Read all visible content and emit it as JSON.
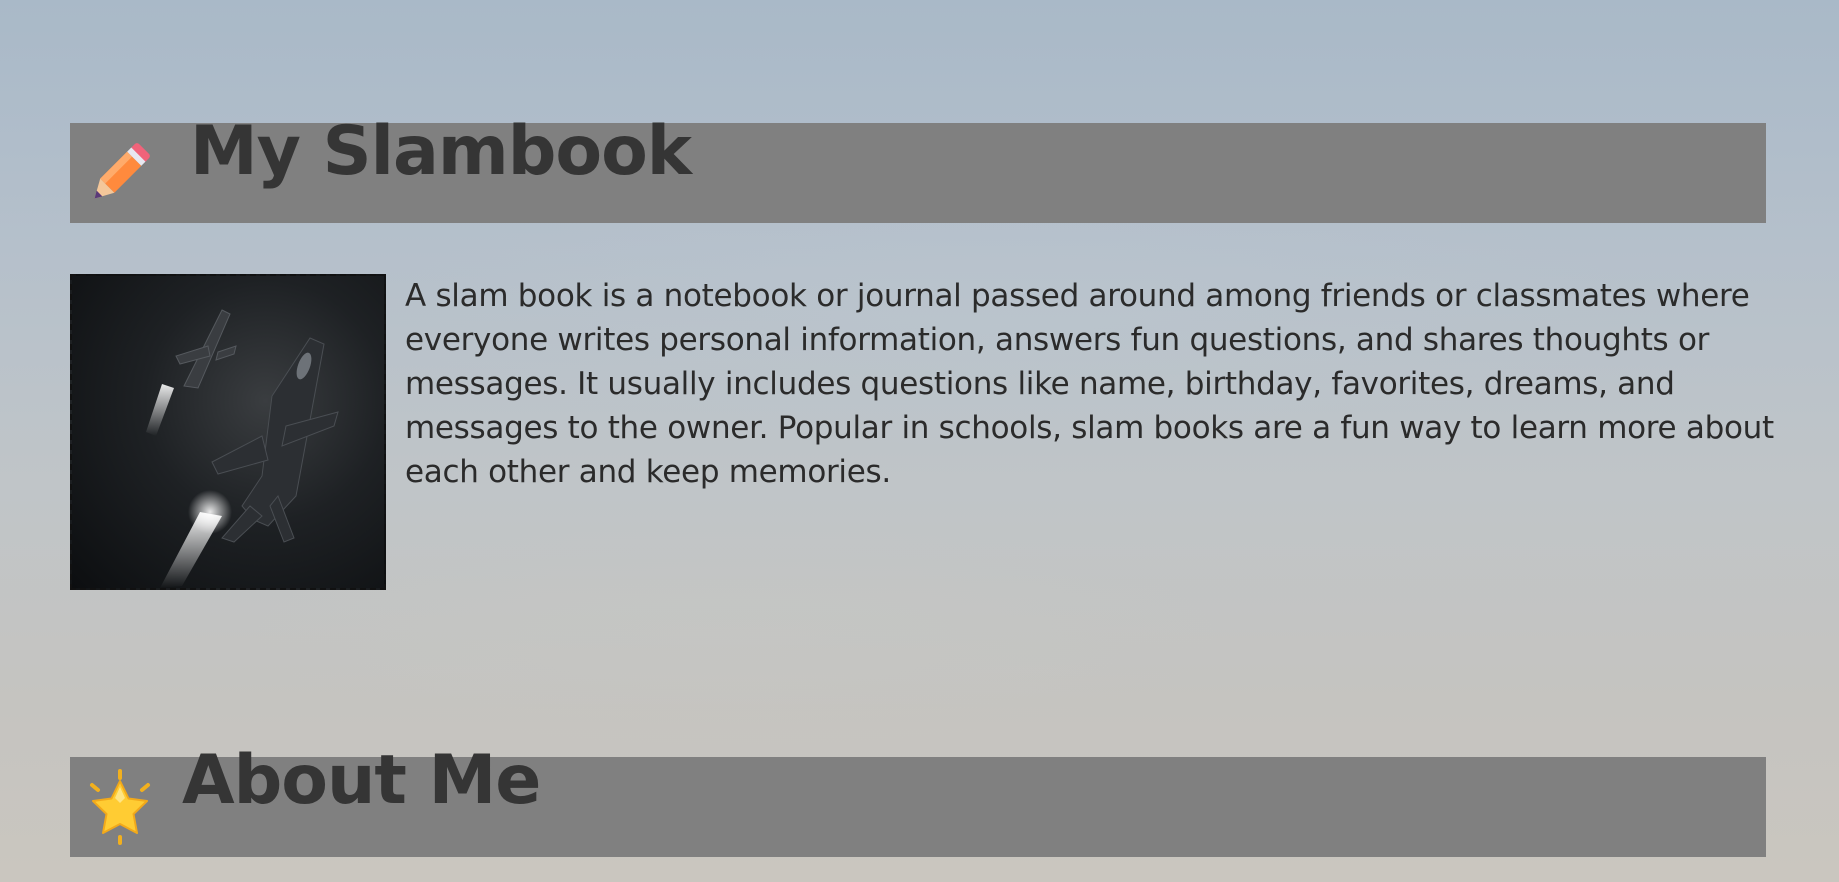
{
  "sections": {
    "slambook": {
      "icon": "pencil-icon",
      "title": "My Slambook"
    },
    "about": {
      "icon": "star-icon",
      "title": "About Me"
    }
  },
  "intro": {
    "image": "fighter-jets-photo",
    "text": "A slam book is a notebook or journal passed around among friends or classmates where everyone writes personal information, answers fun questions, and shares thoughts or messages. It usually includes questions like name, birthday, favorites, dreams, and messages to the owner. Popular in schools, slam books are a fun way to learn more about each other and keep memories."
  },
  "colors": {
    "header_bar": "#808080",
    "header_text": "#353535",
    "body_text": "#2b2b2b"
  }
}
